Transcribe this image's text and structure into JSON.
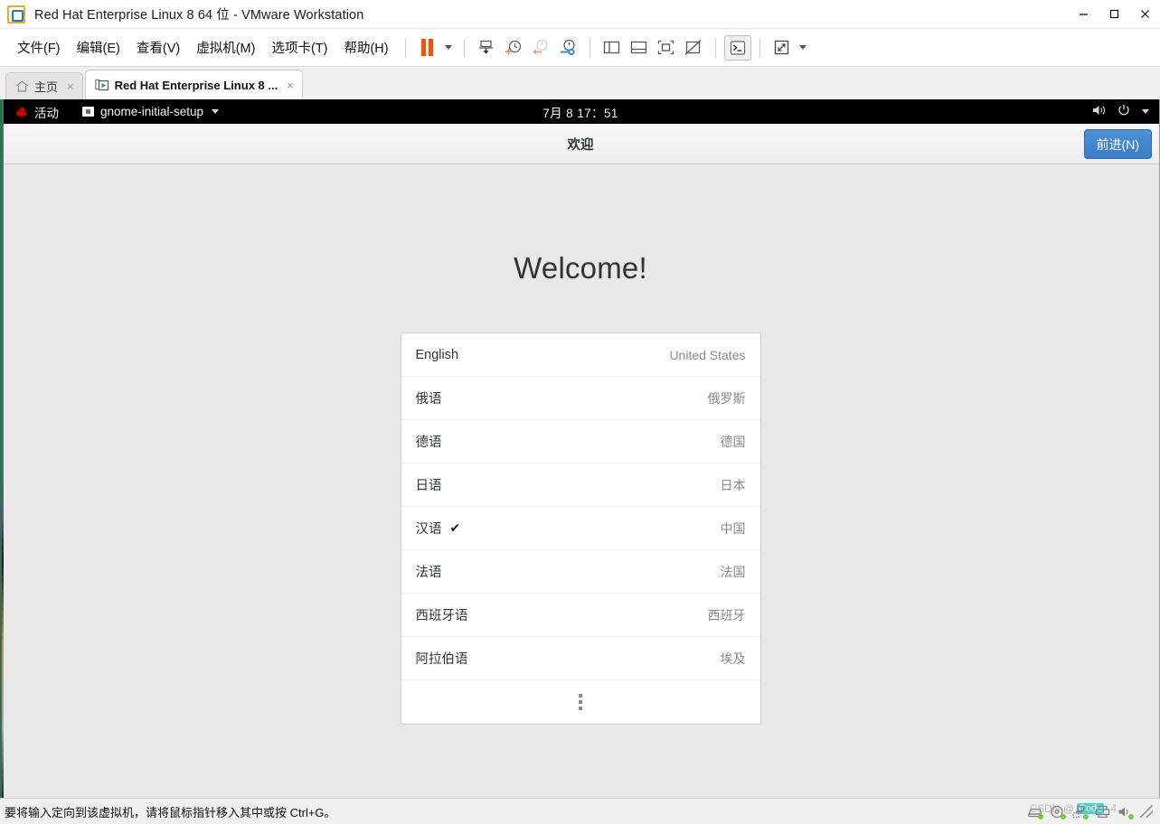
{
  "window": {
    "title": "Red Hat Enterprise Linux 8 64 位 - VMware Workstation",
    "logo_icon": "vmware-logo-icon",
    "controls": [
      {
        "name": "minimize-button",
        "icon": "minimize-icon"
      },
      {
        "name": "maximize-button",
        "icon": "maximize-icon"
      },
      {
        "name": "close-button",
        "icon": "close-icon"
      }
    ]
  },
  "menubar": {
    "items": [
      {
        "label": "文件(F)",
        "name": "menu-file"
      },
      {
        "label": "编辑(E)",
        "name": "menu-edit"
      },
      {
        "label": "查看(V)",
        "name": "menu-view"
      },
      {
        "label": "虚拟机(M)",
        "name": "menu-vm"
      },
      {
        "label": "选项卡(T)",
        "name": "menu-tabs"
      },
      {
        "label": "帮助(H)",
        "name": "menu-help"
      }
    ]
  },
  "toolbar": {
    "buttons": [
      {
        "name": "suspend-button",
        "icon": "pause-icon"
      },
      {
        "name": "power-dropdown",
        "icon": "chevron-down-icon"
      },
      {
        "name": "snapshot-manager-button",
        "icon": "snapshot-save-icon"
      },
      {
        "name": "take-snapshot-button",
        "icon": "snapshot-add-icon"
      },
      {
        "name": "revert-snapshot-button",
        "icon": "snapshot-revert-icon"
      },
      {
        "name": "manage-snapshots-button",
        "icon": "snapshot-wrench-icon"
      },
      {
        "name": "show-sidebar-button",
        "icon": "panel-left-icon"
      },
      {
        "name": "show-thumbnail-bar-button",
        "icon": "panel-bottom-icon"
      },
      {
        "name": "fit-guest-button",
        "icon": "fit-window-icon"
      },
      {
        "name": "stretch-guest-button",
        "icon": "no-stretch-icon"
      },
      {
        "name": "console-view-button",
        "icon": "terminal-icon"
      },
      {
        "name": "fullscreen-button",
        "icon": "expand-arrows-icon"
      },
      {
        "name": "fullscreen-dropdown",
        "icon": "chevron-down-icon"
      }
    ]
  },
  "tabs": [
    {
      "name": "tab-home",
      "label": "主页",
      "icon": "home-icon",
      "close_icon": "×",
      "active": false
    },
    {
      "name": "tab-vm",
      "label": "Red Hat Enterprise Linux 8 ...",
      "icon": "vm-running-icon",
      "close_icon": "×",
      "active": true
    }
  ],
  "gnome": {
    "activities": "活动",
    "redhat_icon": "redhat-logo-icon",
    "app_name": "gnome-initial-setup",
    "app_icon": "app-window-icon",
    "app_caret_icon": "chevron-down-icon",
    "clock": "7月 8  17：51",
    "volume_icon": "volume-icon",
    "power_icon": "power-icon",
    "system-menu_icon": "chevron-down-icon"
  },
  "headerbar": {
    "title": "欢迎",
    "next_label": "前进(N)"
  },
  "main": {
    "welcome_title": "Welcome!",
    "languages": [
      {
        "name": "English",
        "country": "United States",
        "selected": false
      },
      {
        "name": "俄语",
        "country": "俄罗斯",
        "selected": false
      },
      {
        "name": "德语",
        "country": "德国",
        "selected": false
      },
      {
        "name": "日语",
        "country": "日本",
        "selected": false
      },
      {
        "name": "汉语",
        "country": "中国",
        "selected": true
      },
      {
        "name": "法语",
        "country": "法国",
        "selected": false
      },
      {
        "name": "西班牙语",
        "country": "西班牙",
        "selected": false
      },
      {
        "name": "阿拉伯语",
        "country": "埃及",
        "selected": false
      }
    ],
    "check_mark": "✔",
    "more_icon": "more-vertical-icon"
  },
  "statusbar": {
    "message": "要将输入定向到该虚拟机，请将鼠标指针移入其中或按 Ctrl+G。",
    "devices": [
      {
        "name": "hard-disk-icon"
      },
      {
        "name": "cd-dvd-icon"
      },
      {
        "name": "network-adapter-icon"
      },
      {
        "name": "printer-icon"
      },
      {
        "name": "sound-card-icon"
      }
    ],
    "watermark": {
      "prefix": "CSDN @",
      "badge": "Code",
      "suffix": "-4"
    },
    "resize_grip_icon": "resize-grip-icon"
  },
  "colors": {
    "accent_blue": "#4a90d9",
    "vmware_orange": "#e8540d",
    "guest_bg": "#e8e8e7",
    "gnome_bar": "#000000"
  }
}
